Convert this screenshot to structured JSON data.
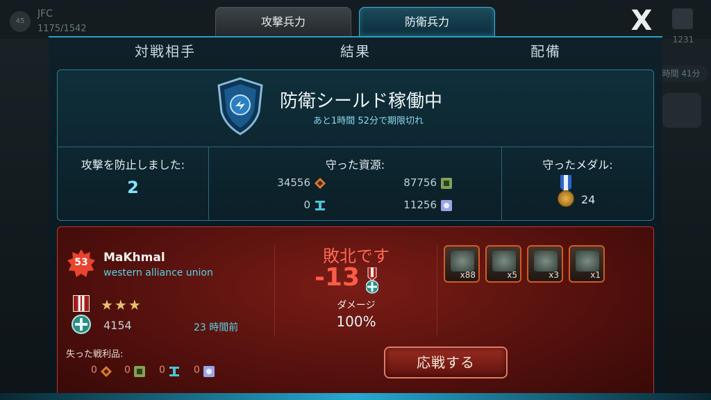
{
  "background": {
    "player_level": "45",
    "player_name": "JFC",
    "player_hp": "1175/1542",
    "right_resource": "1231",
    "right_timer": "時間 41分"
  },
  "tabs": {
    "attack": "攻撃兵力",
    "defense": "防衛兵力",
    "close": "X"
  },
  "subheads": {
    "opponent": "対戦相手",
    "result": "結果",
    "deploy": "配備"
  },
  "shield": {
    "title": "防衛シールド稼働中",
    "subtitle": "あと1時間 52分で期限切れ"
  },
  "stats": {
    "blocked_label": "攻撃を防止しました:",
    "blocked_value": "2",
    "resources_label": "守った資源:",
    "res_orange": "34556",
    "res_green": "87756",
    "res_steel": "0",
    "res_blue": "11256",
    "medals_label": "守ったメダル:",
    "medals_value": "24"
  },
  "battle": {
    "level": "53",
    "name": "MaKhmal",
    "alliance": "western alliance union",
    "stars": "★★★",
    "trophies": "4154",
    "time_ago": "23 時間前",
    "result_title": "敗北です",
    "result_delta": "-13",
    "damage_label": "ダメージ",
    "damage_value": "100%",
    "units": [
      {
        "name": "soldier",
        "count": "x88"
      },
      {
        "name": "turret",
        "count": "x5"
      },
      {
        "name": "tank",
        "count": "x3"
      },
      {
        "name": "mech",
        "count": "x1"
      }
    ],
    "lost_label": "失った戦利品:",
    "lost": [
      "0",
      "0",
      "0",
      "0"
    ],
    "retaliate_label": "応戦する"
  },
  "colors": {
    "accent_blue": "#2aa0c6",
    "defeat_red": "#ff5b45",
    "panel_red": "#4a0e0b"
  }
}
